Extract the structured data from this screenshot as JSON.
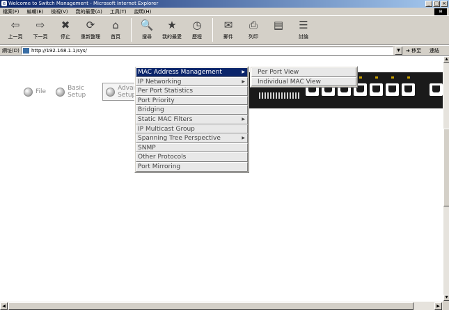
{
  "window": {
    "title": "Welcome to Switch Management - Microsoft Internet Explorer",
    "controls": [
      "_",
      "□",
      "×"
    ]
  },
  "menubar": {
    "items": [
      "檔案(F)",
      "編輯(E)",
      "檢視(V)",
      "我的最愛(A)",
      "工具(T)",
      "說明(H)"
    ]
  },
  "toolbar": {
    "buttons": [
      {
        "label": "上一頁",
        "icon": "back-arrow-icon",
        "glyph": "⇦"
      },
      {
        "label": "下一頁",
        "icon": "forward-arrow-icon",
        "glyph": "⇨"
      },
      {
        "label": "停止",
        "icon": "stop-icon",
        "glyph": "✖"
      },
      {
        "label": "重新整理",
        "icon": "refresh-icon",
        "glyph": "⟳"
      },
      {
        "label": "首頁",
        "icon": "home-icon",
        "glyph": "⌂"
      },
      {
        "label": "搜尋",
        "icon": "search-icon",
        "glyph": "🔍"
      },
      {
        "label": "我的最愛",
        "icon": "favorites-icon",
        "glyph": "★"
      },
      {
        "label": "歷程",
        "icon": "history-icon",
        "glyph": "◷"
      },
      {
        "label": "郵件",
        "icon": "mail-icon",
        "glyph": "✉"
      },
      {
        "label": "列印",
        "icon": "print-icon",
        "glyph": "⎙"
      },
      {
        "label": "",
        "icon": "edit-icon",
        "glyph": "▤"
      },
      {
        "label": "討論",
        "icon": "discuss-icon",
        "glyph": "☰"
      }
    ]
  },
  "address": {
    "label": "網址(D)",
    "url": "http://192.168.1.1/sys/",
    "go_label": "移至",
    "links_label": "連結"
  },
  "nav": {
    "file": "File",
    "basic_setup": "Basic Setup",
    "advanced_setup": "Advanced Setup"
  },
  "menu": {
    "items": [
      {
        "label": "MAC Address Management",
        "has_submenu": true,
        "active": true
      },
      {
        "label": "IP Networking",
        "has_submenu": true
      },
      {
        "label": "Per Port Statistics",
        "has_submenu": false
      },
      {
        "label": "Port Priority",
        "has_submenu": false
      },
      {
        "label": "Bridging",
        "has_submenu": false
      },
      {
        "label": "Static MAC Filters",
        "has_submenu": true
      },
      {
        "label": "IP Multicast Group",
        "has_submenu": false
      },
      {
        "label": "Spanning Tree Perspective",
        "has_submenu": true
      },
      {
        "label": "SNMP",
        "has_submenu": false
      },
      {
        "label": "Other Protocols",
        "has_submenu": false
      },
      {
        "label": "Port Mirroring",
        "has_submenu": false
      }
    ]
  },
  "submenu": {
    "items": [
      "Per Port View",
      "Individual MAC View"
    ]
  },
  "colors": {
    "titlebar": "#0a246a",
    "chrome": "#d4d0c8",
    "highlight": "#0a246a",
    "device": "#1a1a1a"
  }
}
